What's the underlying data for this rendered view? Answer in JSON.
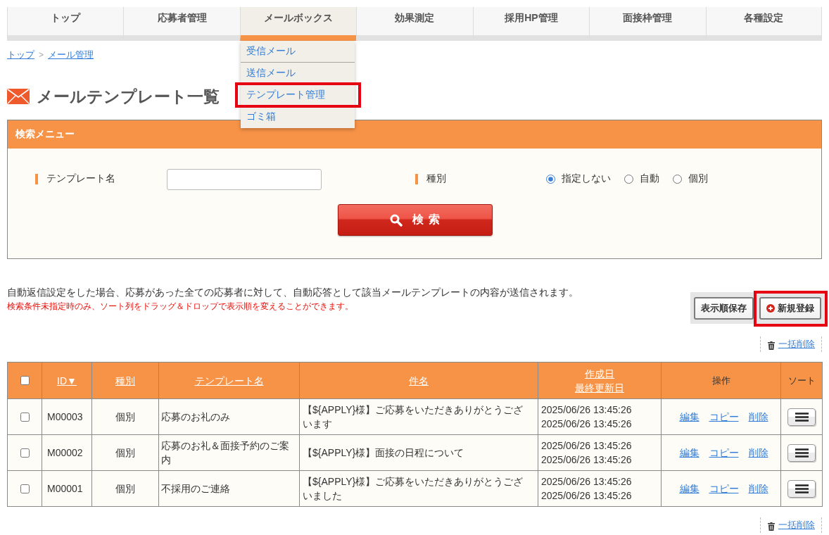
{
  "nav": {
    "items": [
      {
        "label": "トップ",
        "selected": false
      },
      {
        "label": "応募者管理",
        "selected": false
      },
      {
        "label": "メールボックス",
        "selected": true
      },
      {
        "label": "効果測定",
        "selected": false
      },
      {
        "label": "採用HP管理",
        "selected": false
      },
      {
        "label": "面接枠管理",
        "selected": false
      },
      {
        "label": "各種設定",
        "selected": false
      }
    ]
  },
  "mailbox_menu": {
    "items": [
      {
        "label": "受信メール",
        "annotated": false
      },
      {
        "label": "送信メール",
        "annotated": false
      },
      {
        "label": "テンプレート管理",
        "annotated": true
      },
      {
        "label": "ゴミ箱",
        "annotated": false
      }
    ]
  },
  "breadcrumb": {
    "items": [
      "トップ",
      "メール管理"
    ],
    "separator": ">"
  },
  "page_title": "メールテンプレート一覧",
  "search_panel": {
    "title": "検索メニュー",
    "fields": [
      {
        "kind": "text",
        "label": "テンプレート名"
      },
      {
        "kind": "radio",
        "label": "種別",
        "options": [
          {
            "label": "指定しない",
            "selected": true
          },
          {
            "label": "自動",
            "selected": false
          },
          {
            "label": "個別",
            "selected": false
          }
        ]
      }
    ],
    "button": "検 索"
  },
  "notice": "自動返信設定をした場合、応募があった全ての応募者に対して、自動応答として該当メールテンプレートの内容が送信されます。",
  "warning": "検索条件未指定時のみ、ソート列をドラッグ＆ドロップで表示順を変えることができます。",
  "toolbar": {
    "buttons": [
      {
        "kind": "plain",
        "label": "表示順保存",
        "annotated": false
      },
      {
        "kind": "add",
        "label": "新規登録",
        "annotated": true
      }
    ]
  },
  "bulk_delete_top": "一括削除",
  "table": {
    "columns": [
      {
        "kind": "checkbox",
        "checked": false
      },
      {
        "kind": "link",
        "lines": [
          "ID▼"
        ]
      },
      {
        "kind": "link",
        "lines": [
          "種別"
        ]
      },
      {
        "kind": "link",
        "lines": [
          "テンプレート名"
        ]
      },
      {
        "kind": "link",
        "lines": [
          "件名"
        ]
      },
      {
        "kind": "link",
        "lines": [
          "作成日",
          "最終更新日"
        ]
      },
      {
        "kind": "text",
        "lines": [
          "操作"
        ]
      },
      {
        "kind": "text",
        "lines": [
          "ソート"
        ]
      }
    ],
    "rows": [
      {
        "checked": false,
        "id": "M00003",
        "type": "個別",
        "name": "応募のお礼のみ",
        "subject": "【${APPLY}様】ご応募をいただきありがとうございます",
        "created": "2025/06/26 13:45:26",
        "updated": "2025/06/26 13:45:26",
        "actions": [
          "編集",
          "コピー",
          "削除"
        ]
      },
      {
        "checked": false,
        "id": "M00002",
        "type": "個別",
        "name": "応募のお礼＆面接予約のご案内",
        "subject": "【${APPLY}様】面接の日程について",
        "created": "2025/06/26 13:45:26",
        "updated": "2025/06/26 13:45:26",
        "actions": [
          "編集",
          "コピー",
          "削除"
        ]
      },
      {
        "checked": false,
        "id": "M00001",
        "type": "個別",
        "name": "不採用のご連絡",
        "subject": "【${APPLY}様】ご応募をいただきありがとうございました",
        "created": "2025/06/26 13:45:26",
        "updated": "2025/06/26 13:45:26",
        "actions": [
          "編集",
          "コピー",
          "削除"
        ]
      }
    ]
  },
  "bulk_delete_bottom": "一括削除"
}
